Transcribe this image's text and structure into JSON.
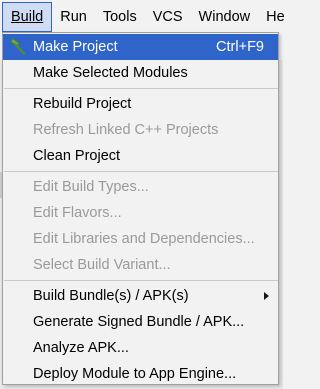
{
  "menubar": {
    "items": [
      {
        "label": "Build",
        "active": true
      },
      {
        "label": "Run",
        "active": false
      },
      {
        "label": "Tools",
        "active": false
      },
      {
        "label": "VCS",
        "active": false
      },
      {
        "label": "Window",
        "active": false
      },
      {
        "label": "He",
        "active": false
      }
    ]
  },
  "dropdown": {
    "group1": {
      "make_project": {
        "label": "Make Project",
        "shortcut": "Ctrl+F9",
        "icon": "hammer-icon"
      },
      "make_selected_modules": {
        "label": "Make Selected Modules"
      }
    },
    "group2": {
      "rebuild_project": {
        "label": "Rebuild Project"
      },
      "refresh_linked_cpp": {
        "label": "Refresh Linked C++ Projects"
      },
      "clean_project": {
        "label": "Clean Project"
      }
    },
    "group3": {
      "edit_build_types": {
        "label": "Edit Build Types..."
      },
      "edit_flavors": {
        "label": "Edit Flavors..."
      },
      "edit_libraries": {
        "label": "Edit Libraries and Dependencies..."
      },
      "select_build_variant": {
        "label": "Select Build Variant..."
      }
    },
    "group4": {
      "build_bundles": {
        "label": "Build Bundle(s) / APK(s)"
      },
      "generate_signed": {
        "label": "Generate Signed Bundle / APK..."
      },
      "analyze_apk": {
        "label": "Analyze APK..."
      },
      "deploy_module": {
        "label": "Deploy Module to App Engine..."
      }
    }
  },
  "colors": {
    "highlight": "#2f65ca",
    "disabled_text": "#9a9a9a",
    "menu_background": "#f2f2f2"
  }
}
